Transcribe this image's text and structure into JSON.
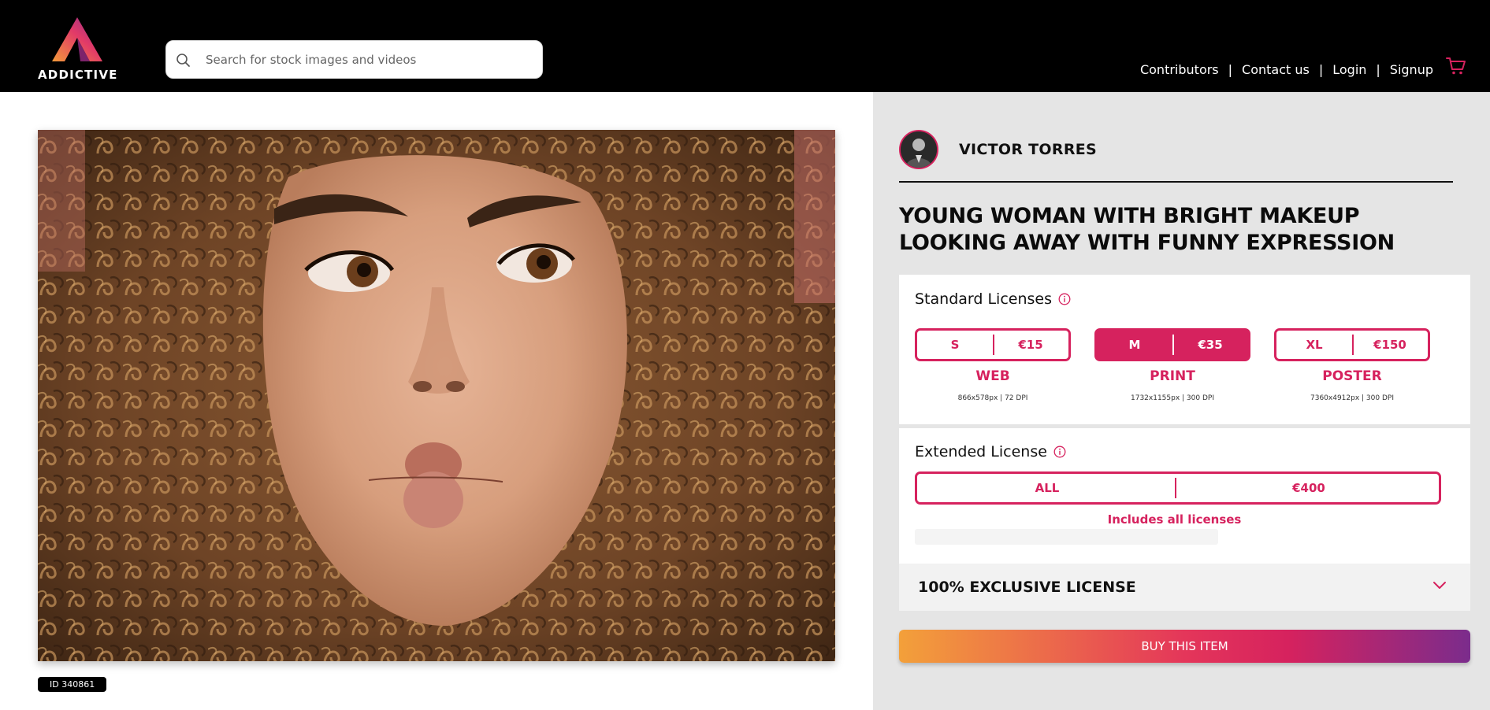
{
  "brand": {
    "name": "ADDICTIVE"
  },
  "search": {
    "placeholder": "Search for stock images and videos"
  },
  "nav": {
    "items": [
      "Contributors",
      "Contact us",
      "Login",
      "Signup"
    ],
    "separator": "|"
  },
  "photo": {
    "id_label": "ID 340861"
  },
  "author": {
    "name": "VICTOR TORRES"
  },
  "item": {
    "title": "YOUNG WOMAN WITH BRIGHT MAKEUP LOOKING AWAY WITH FUNNY EXPRESSION"
  },
  "standard": {
    "title": "Standard Licenses",
    "options": [
      {
        "size": "S",
        "price": "€15",
        "use": "WEB",
        "dims": "866x578px | 72 DPI",
        "selected": false
      },
      {
        "size": "M",
        "price": "€35",
        "use": "PRINT",
        "dims": "1732x1155px | 300 DPI",
        "selected": true
      },
      {
        "size": "XL",
        "price": "€150",
        "use": "POSTER",
        "dims": "7360x4912px | 300 DPI",
        "selected": false
      }
    ]
  },
  "extended": {
    "title": "Extended License",
    "size": "ALL",
    "price": "€400",
    "note": "Includes all licenses"
  },
  "exclusive": {
    "label": "100% EXCLUSIVE LICENSE"
  },
  "buy": {
    "label": "BUY THIS ITEM"
  },
  "colors": {
    "accent": "#d6225e",
    "header_bg": "#000000",
    "panel_bg": "#e5e5e5",
    "gradient": [
      "#f3a03a",
      "#d6225e",
      "#7b2c8c"
    ]
  }
}
